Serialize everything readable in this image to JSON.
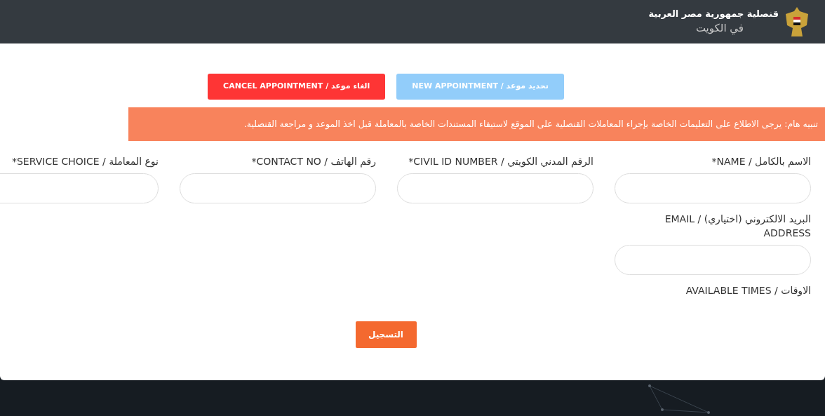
{
  "header": {
    "title": "قنصلية جمهورية مصر العربية",
    "subtitle": "في الكويت"
  },
  "actions": [
    {
      "label": "تحديد موعد / NEW APPOINTMENT",
      "kind": "primary"
    },
    {
      "label": "الغاء موعد / CANCEL APPOINTMENT",
      "kind": "danger"
    }
  ],
  "notice": "تنبيه هام: يرجى الاطلاع على التعليمات الخاصة بإجراء المعاملات القنصلية على الموقع لاستيفاء المستندات الخاصة بالمعاملة قبل اخذ الموعد و مراجعة القنصلية.",
  "fields": [
    {
      "label": "الاسم بالكامل / NAME*"
    },
    {
      "label": "الرقم المدني الكويتي / CIVIL ID NUMBER*"
    },
    {
      "label": "رقم الهاتف / CONTACT NO*"
    },
    {
      "label": "نوع المعاملة / SERVICE CHOICE*"
    }
  ],
  "email_field": {
    "label": "البريد الالكتروني (اختياري) / EMAIL ADDRESS"
  },
  "times_label": "الاوقات / AVAILABLE TIMES",
  "submit": "التسجيل"
}
